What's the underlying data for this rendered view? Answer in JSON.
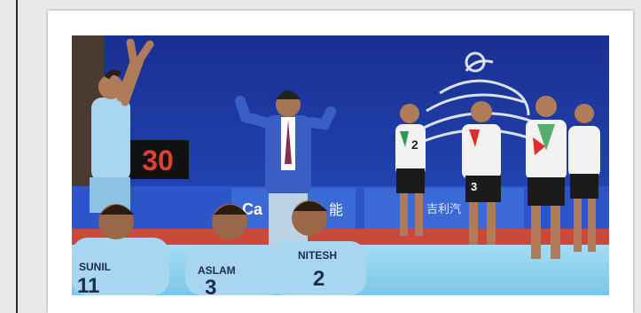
{
  "photo": {
    "scoreboard": "30",
    "players_front": [
      {
        "name": "SUNIL",
        "number": "11"
      },
      {
        "name": "ASLAM",
        "number": "3"
      },
      {
        "name": "NITESH",
        "number": "2"
      }
    ],
    "opponents": [
      {
        "number": "2"
      },
      {
        "number": "3"
      }
    ],
    "banner_text": "Ca",
    "banner_text_cjk": "能",
    "banner_text_right": "吉利汽"
  },
  "colors": {
    "wall_blue": "#1e3aa6",
    "court_blue": "#8fd0ee",
    "court_red": "#c0392b",
    "india_kit": "#9fd1ee",
    "iran_kit": "#f2f2f2"
  }
}
